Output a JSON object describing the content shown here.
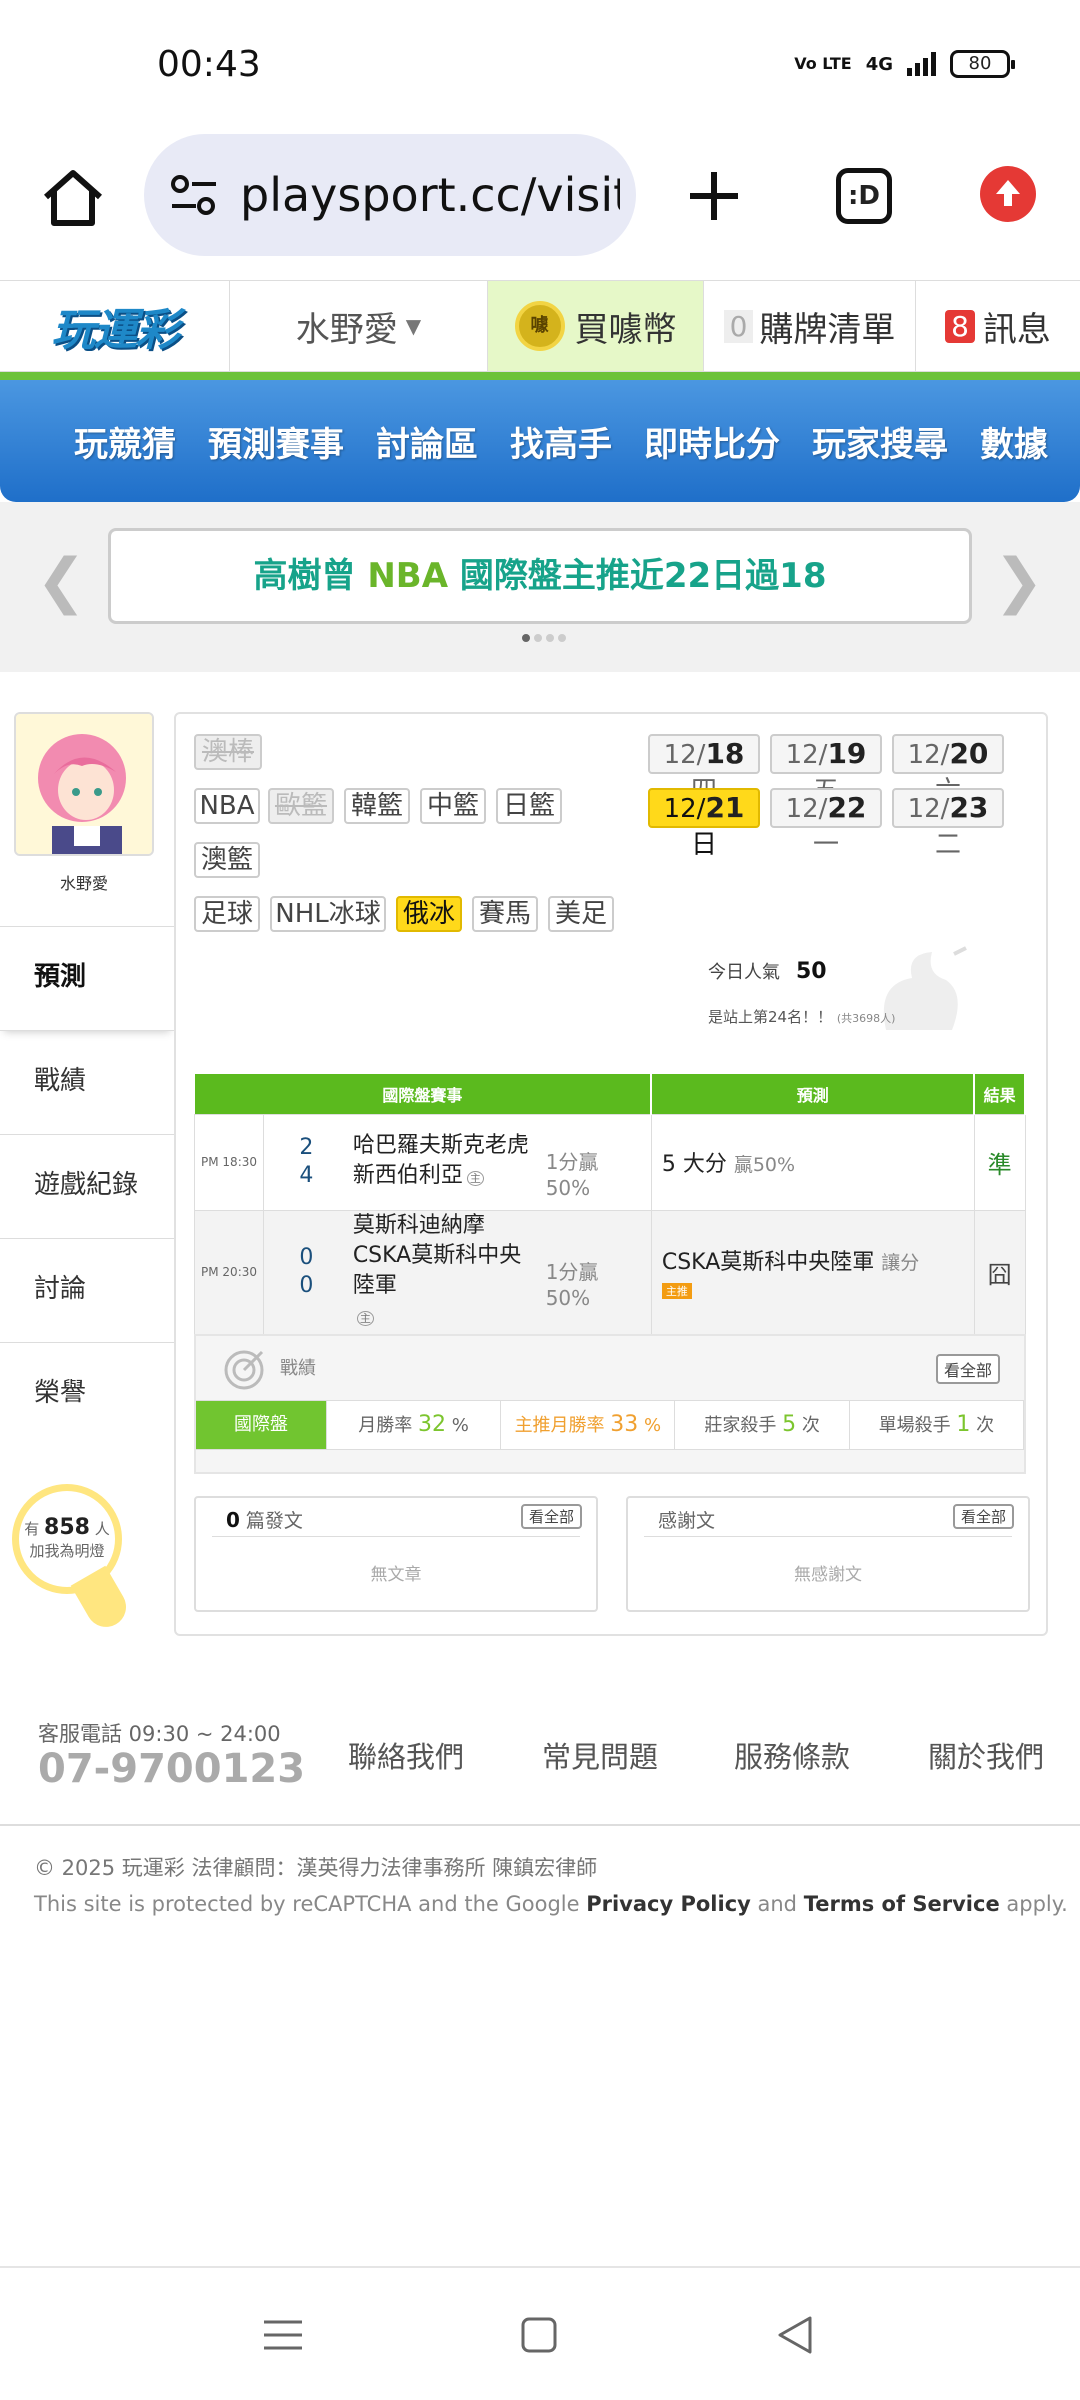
{
  "status": {
    "time": "00:43",
    "volte": "Vo LTE",
    "network": "4G",
    "battery": "80"
  },
  "browser": {
    "url": "playsport.cc/visit",
    "tab_label": ":D"
  },
  "site_header": {
    "logo": "玩運彩",
    "username": "水野愛",
    "buy_coin": "買噱幣",
    "coin_text": "噱",
    "cart_count": "0",
    "cart_label": "購牌清單",
    "msg_count": "8",
    "msg_label": "訊息"
  },
  "nav": [
    "玩競猜",
    "預測賽事",
    "討論區",
    "找高手",
    "即時比分",
    "玩家搜尋",
    "數據"
  ],
  "banner": {
    "prefix": "高樹曾 ",
    "highlight": "NBA",
    "suffix": " 國際盤主推近22日過18"
  },
  "profile": {
    "name": "水野愛"
  },
  "sidebar": [
    "預測",
    "戰績",
    "遊戲紀錄",
    "討論",
    "榮譽"
  ],
  "fans": {
    "prefix": "有",
    "count": "858",
    "unit": "人",
    "line2": "加我為明燈"
  },
  "sports_tags": [
    "澳棒",
    "NBA",
    "歐籃",
    "韓籃",
    "中籃",
    "日籃",
    "澳籃",
    "足球",
    "NHL冰球",
    "俄冰",
    "賽馬",
    "美足"
  ],
  "dates": [
    {
      "md": "12/",
      "day": "18",
      "wk": " 四"
    },
    {
      "md": "12/",
      "day": "19",
      "wk": " 五"
    },
    {
      "md": "12/",
      "day": "20",
      "wk": " 六"
    },
    {
      "md": "12/",
      "day": "21",
      "wk": " 日"
    },
    {
      "md": "12/",
      "day": "22",
      "wk": " 一"
    },
    {
      "md": "12/",
      "day": "23",
      "wk": " 二"
    }
  ],
  "popularity": {
    "label": "今日人氣",
    "value": "50",
    "rank": "是站上第24名！！",
    "total": "(共3698人)"
  },
  "table": {
    "headers": [
      "國際盤賽事",
      "預測",
      "結果"
    ],
    "games": [
      {
        "time": "PM 18:30",
        "score1": "2",
        "score2": "4",
        "team1": "哈巴羅夫斯克老虎",
        "team2": "新西伯利亞",
        "line": "1分贏",
        "pct": "50%",
        "pred": "5 大分",
        "pred_note": "贏50%",
        "result": "準"
      },
      {
        "time": "PM 20:30",
        "score1": "0",
        "score2": "0",
        "team1": "莫斯科迪納摩",
        "team2": "CSKA莫斯科中央陸軍",
        "line": "1分贏",
        "pct": "50%",
        "pred": "CSKA莫斯科中央陸軍",
        "pred_note": "讓分",
        "badge": "主推",
        "result": "囧"
      }
    ],
    "home_mark": "主"
  },
  "record": {
    "title": "戰績",
    "view_all": "看全部",
    "tab": "國際盤",
    "monthly_label": "月勝率",
    "monthly_value": "32",
    "main_label": "主推月勝率",
    "main_value": "33",
    "pct": "%",
    "banker_label": "莊家殺手",
    "banker_value": "5",
    "single_label": "單場殺手",
    "single_value": "1",
    "times": "次"
  },
  "posts": {
    "count": "0",
    "label": "篇發文",
    "view_all": "看全部",
    "empty": "無文章"
  },
  "thanks": {
    "label": "感謝文",
    "view_all": "看全部",
    "empty": "無感謝文"
  },
  "footer": {
    "service": "客服電話 09:30 ~ 24:00",
    "phone": "07-9700123",
    "links": [
      "聯絡我們",
      "常見問題",
      "服務條款",
      "關於我們"
    ],
    "copyright": "© 2025 玩運彩 法律顧問：漢英得力法律事務所 陳鎮宏律師",
    "captcha_pre": "This site is protected by reCAPTCHA and the Google ",
    "privacy": "Privacy Policy",
    "and": " and ",
    "terms": "Terms of Service",
    "apply": " apply."
  },
  "colors": {
    "accent_green": "#5bba1e",
    "nav_blue": "#1f6fc9",
    "highlight_yellow": "#ffd91a",
    "alert_red": "#e53935"
  }
}
